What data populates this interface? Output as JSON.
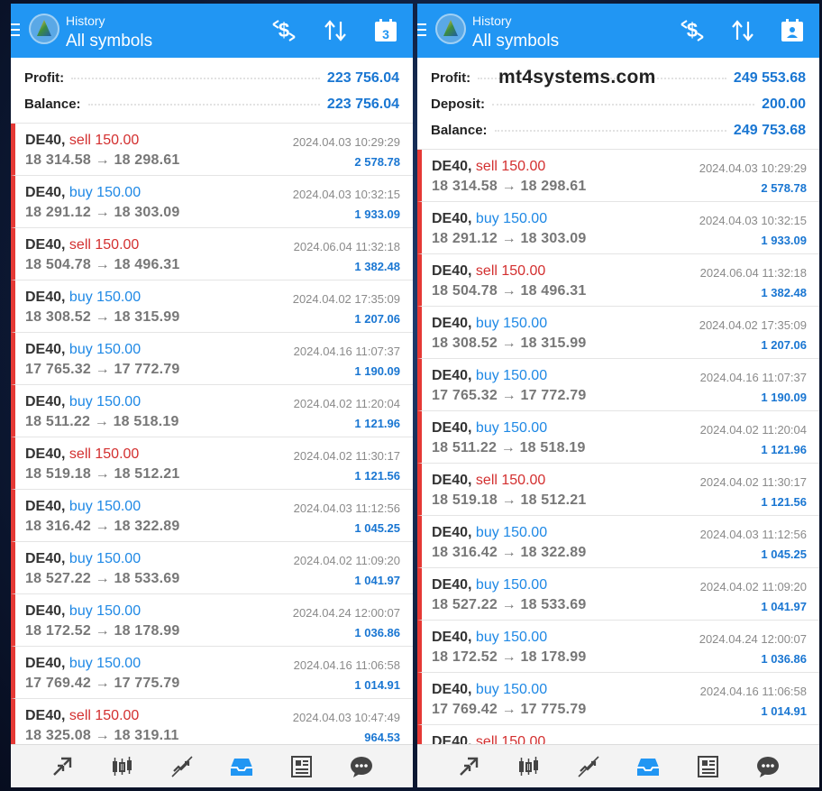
{
  "colors": {
    "accent": "#2196f3",
    "sell": "#d32f2f",
    "buy": "#1e88e5",
    "profit": "#1976d2",
    "row_bar": "#e53935"
  },
  "left": {
    "header": {
      "small": "History",
      "big": "All symbols",
      "calendar_day": "3"
    },
    "summary": [
      {
        "label": "Profit:",
        "value": "223 756.04"
      },
      {
        "label": "Balance:",
        "value": "223 756.04"
      }
    ],
    "trades": [
      {
        "symbol": "DE40,",
        "type": "sell",
        "lots": "sell 150.00",
        "prices": "18 314.58 → 18 298.61",
        "time": "2024.04.03 10:29:29",
        "profit": "2 578.78"
      },
      {
        "symbol": "DE40,",
        "type": "buy",
        "lots": "buy 150.00",
        "prices": "18 291.12 → 18 303.09",
        "time": "2024.04.03 10:32:15",
        "profit": "1 933.09"
      },
      {
        "symbol": "DE40,",
        "type": "sell",
        "lots": "sell 150.00",
        "prices": "18 504.78 → 18 496.31",
        "time": "2024.06.04 11:32:18",
        "profit": "1 382.48"
      },
      {
        "symbol": "DE40,",
        "type": "buy",
        "lots": "buy 150.00",
        "prices": "18 308.52 → 18 315.99",
        "time": "2024.04.02 17:35:09",
        "profit": "1 207.06"
      },
      {
        "symbol": "DE40,",
        "type": "buy",
        "lots": "buy 150.00",
        "prices": "17 765.32 → 17 772.79",
        "time": "2024.04.16 11:07:37",
        "profit": "1 190.09"
      },
      {
        "symbol": "DE40,",
        "type": "buy",
        "lots": "buy 150.00",
        "prices": "18 511.22 → 18 518.19",
        "time": "2024.04.02 11:20:04",
        "profit": "1 121.96"
      },
      {
        "symbol": "DE40,",
        "type": "sell",
        "lots": "sell 150.00",
        "prices": "18 519.18 → 18 512.21",
        "time": "2024.04.02 11:30:17",
        "profit": "1 121.56"
      },
      {
        "symbol": "DE40,",
        "type": "buy",
        "lots": "buy 150.00",
        "prices": "18 316.42 → 18 322.89",
        "time": "2024.04.03 11:12:56",
        "profit": "1 045.25"
      },
      {
        "symbol": "DE40,",
        "type": "buy",
        "lots": "buy 150.00",
        "prices": "18 527.22 → 18 533.69",
        "time": "2024.04.02 11:09:20",
        "profit": "1 041.97"
      },
      {
        "symbol": "DE40,",
        "type": "buy",
        "lots": "buy 150.00",
        "prices": "18 172.52 → 18 178.99",
        "time": "2024.04.24 12:00:07",
        "profit": "1 036.86"
      },
      {
        "symbol": "DE40,",
        "type": "buy",
        "lots": "buy 150.00",
        "prices": "17 769.42 → 17 775.79",
        "time": "2024.04.16 11:06:58",
        "profit": "1 014.91"
      },
      {
        "symbol": "DE40,",
        "type": "sell",
        "lots": "sell 150.00",
        "prices": "18 325.08 → 18 319.11",
        "time": "2024.04.03 10:47:49",
        "profit": "964.53"
      }
    ]
  },
  "right": {
    "header": {
      "small": "History",
      "big": "All symbols"
    },
    "watermark": "mt4systems.com",
    "summary": [
      {
        "label": "Profit:",
        "value": "249 553.68"
      },
      {
        "label": "Deposit:",
        "value": "200.00"
      },
      {
        "label": "Balance:",
        "value": "249 753.68"
      }
    ],
    "trades": [
      {
        "symbol": "DE40,",
        "type": "sell",
        "lots": "sell 150.00",
        "prices": "18 314.58 → 18 298.61",
        "time": "2024.04.03 10:29:29",
        "profit": "2 578.78"
      },
      {
        "symbol": "DE40,",
        "type": "buy",
        "lots": "buy 150.00",
        "prices": "18 291.12 → 18 303.09",
        "time": "2024.04.03 10:32:15",
        "profit": "1 933.09"
      },
      {
        "symbol": "DE40,",
        "type": "sell",
        "lots": "sell 150.00",
        "prices": "18 504.78 → 18 496.31",
        "time": "2024.06.04 11:32:18",
        "profit": "1 382.48"
      },
      {
        "symbol": "DE40,",
        "type": "buy",
        "lots": "buy 150.00",
        "prices": "18 308.52 → 18 315.99",
        "time": "2024.04.02 17:35:09",
        "profit": "1 207.06"
      },
      {
        "symbol": "DE40,",
        "type": "buy",
        "lots": "buy 150.00",
        "prices": "17 765.32 → 17 772.79",
        "time": "2024.04.16 11:07:37",
        "profit": "1 190.09"
      },
      {
        "symbol": "DE40,",
        "type": "buy",
        "lots": "buy 150.00",
        "prices": "18 511.22 → 18 518.19",
        "time": "2024.04.02 11:20:04",
        "profit": "1 121.96"
      },
      {
        "symbol": "DE40,",
        "type": "sell",
        "lots": "sell 150.00",
        "prices": "18 519.18 → 18 512.21",
        "time": "2024.04.02 11:30:17",
        "profit": "1 121.56"
      },
      {
        "symbol": "DE40,",
        "type": "buy",
        "lots": "buy 150.00",
        "prices": "18 316.42 → 18 322.89",
        "time": "2024.04.03 11:12:56",
        "profit": "1 045.25"
      },
      {
        "symbol": "DE40,",
        "type": "buy",
        "lots": "buy 150.00",
        "prices": "18 527.22 → 18 533.69",
        "time": "2024.04.02 11:09:20",
        "profit": "1 041.97"
      },
      {
        "symbol": "DE40,",
        "type": "buy",
        "lots": "buy 150.00",
        "prices": "18 172.52 → 18 178.99",
        "time": "2024.04.24 12:00:07",
        "profit": "1 036.86"
      },
      {
        "symbol": "DE40,",
        "type": "buy",
        "lots": "buy 150.00",
        "prices": "17 769.42 → 17 775.79",
        "time": "2024.04.16 11:06:58",
        "profit": "1 014.91"
      },
      {
        "symbol": "DE40,",
        "type": "sell",
        "lots": "sell 150.00",
        "prices": "",
        "time": "",
        "profit": ""
      }
    ]
  },
  "icons": {
    "appbar": [
      "menu-icon",
      "app-logo-icon",
      "dollar-swap-icon",
      "sort-icon",
      "calendar-icon"
    ],
    "bottom_nav": [
      "quotes-icon",
      "chart-icon",
      "trade-icon",
      "history-icon",
      "news-icon",
      "chat-icon"
    ]
  }
}
